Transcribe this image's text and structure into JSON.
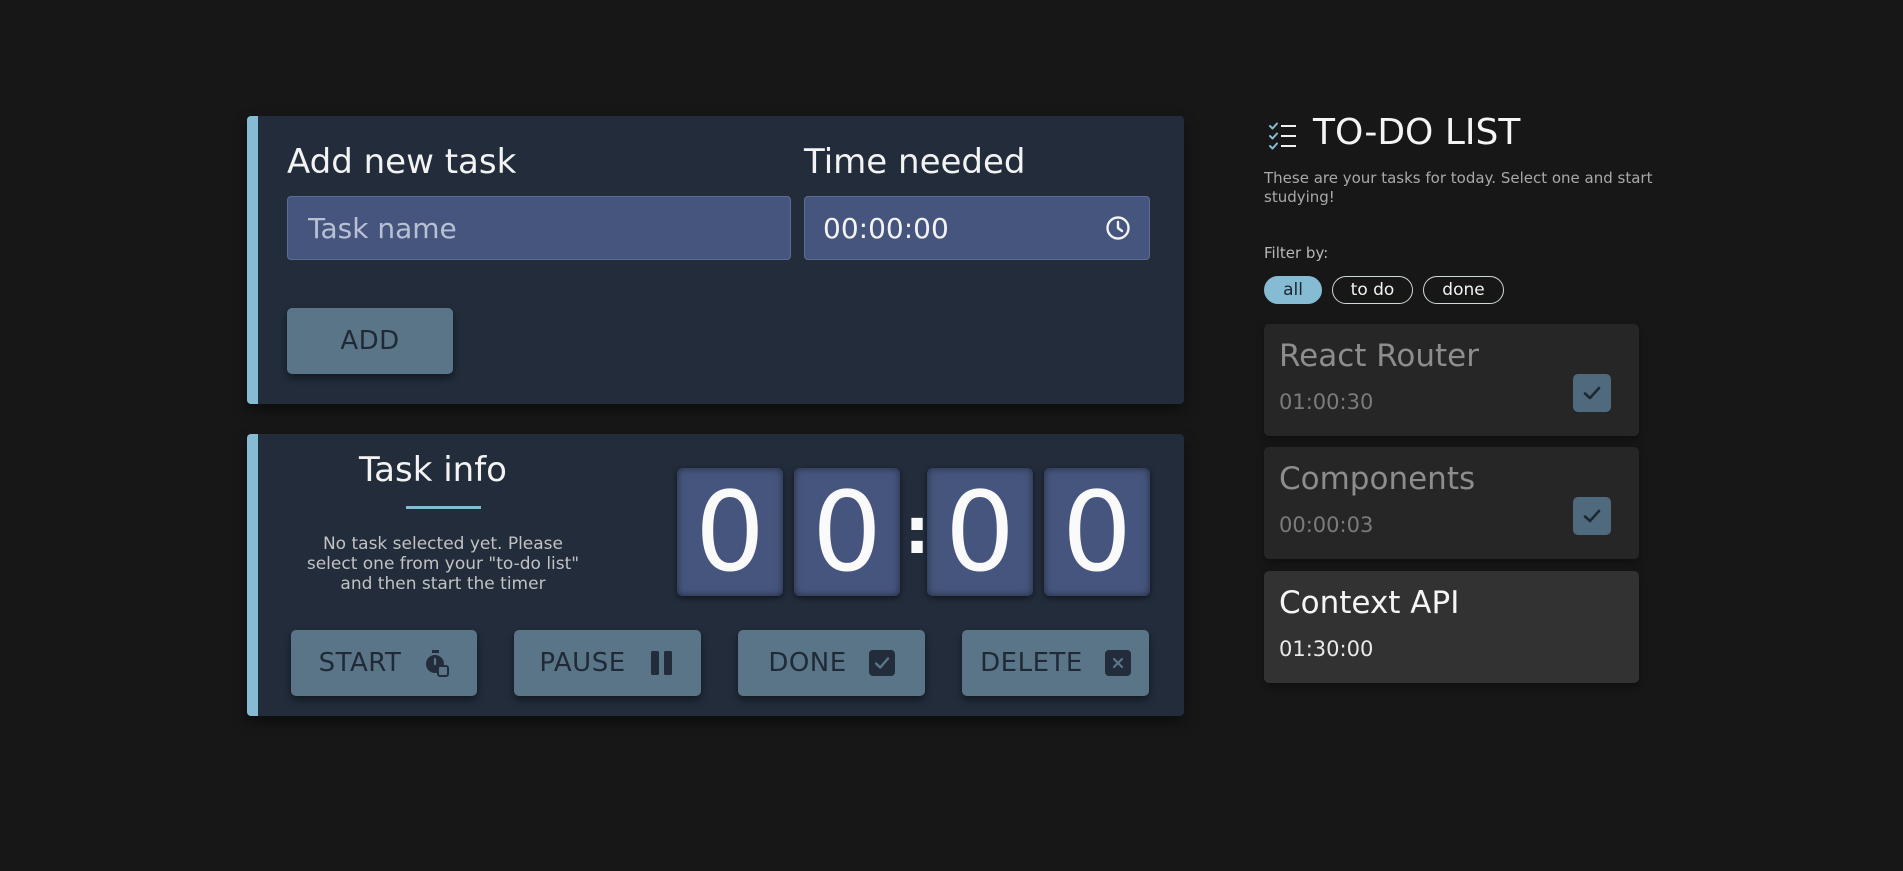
{
  "add_task": {
    "label": "Add new task",
    "name_placeholder": "Task name",
    "time_label": "Time needed",
    "time_value": "00:00:00",
    "add_label": "ADD"
  },
  "task_info": {
    "title": "Task info",
    "message": "No task selected yet. Please select one from your \"to-do list\" and then start the timer",
    "timer": {
      "d1": "0",
      "d2": "0",
      "sep": ":",
      "d3": "0",
      "d4": "0"
    },
    "buttons": {
      "start": "START",
      "pause": "PAUSE",
      "done": "DONE",
      "delete": "DELETE"
    }
  },
  "todo": {
    "title": "TO-DO LIST",
    "subtitle": "These are your tasks for today. Select one and start studying!",
    "filter_label": "Filter by:",
    "filters": [
      {
        "label": "all",
        "active": true
      },
      {
        "label": "to do",
        "active": false
      },
      {
        "label": "done",
        "active": false
      }
    ],
    "tasks": [
      {
        "name": "React Router",
        "time": "01:00:30",
        "done": true
      },
      {
        "name": "Components",
        "time": "00:00:03",
        "done": true
      },
      {
        "name": "Context API",
        "time": "01:30:00",
        "done": false
      }
    ]
  },
  "colors": {
    "background": "#171717",
    "panel": "#222c3b",
    "accent": "#86bcd3",
    "input": "#46557d",
    "button": "#5a7588"
  },
  "icons": {
    "time_input": "clock-icon",
    "start": "stopwatch-icon",
    "pause": "pause-icon",
    "done": "checkbox-icon",
    "delete": "close-box-icon",
    "title": "checklist-icon"
  }
}
